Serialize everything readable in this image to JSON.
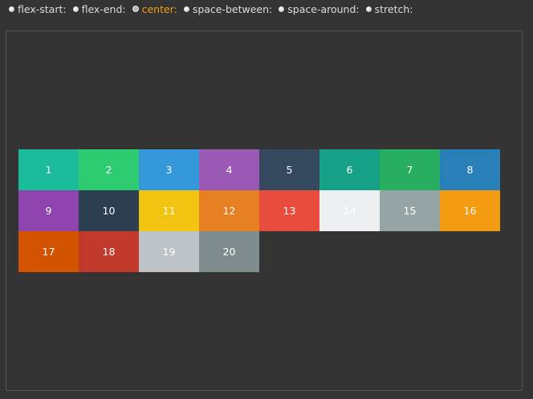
{
  "controls": {
    "options": [
      {
        "label": "flex-start:",
        "selected": false
      },
      {
        "label": "flex-end:",
        "selected": false
      },
      {
        "label": "center:",
        "selected": true
      },
      {
        "label": "space-between:",
        "selected": false
      },
      {
        "label": "space-around:",
        "selected": false
      },
      {
        "label": "stretch:",
        "selected": false
      }
    ],
    "selected_color": "#f39c12"
  },
  "boxes": [
    {
      "label": "1",
      "color": "#1abc9c"
    },
    {
      "label": "2",
      "color": "#2ecc71"
    },
    {
      "label": "3",
      "color": "#3498db"
    },
    {
      "label": "4",
      "color": "#9b59b6"
    },
    {
      "label": "5",
      "color": "#34495e"
    },
    {
      "label": "6",
      "color": "#16a085"
    },
    {
      "label": "7",
      "color": "#27ae60"
    },
    {
      "label": "8",
      "color": "#2980b9"
    },
    {
      "label": "9",
      "color": "#8e44ad"
    },
    {
      "label": "10",
      "color": "#2c3e50"
    },
    {
      "label": "11",
      "color": "#f1c40f"
    },
    {
      "label": "12",
      "color": "#e67e22"
    },
    {
      "label": "13",
      "color": "#e74c3c"
    },
    {
      "label": "14",
      "color": "#ecf0f1"
    },
    {
      "label": "15",
      "color": "#95a5a6"
    },
    {
      "label": "16",
      "color": "#f39c12"
    },
    {
      "label": "17",
      "color": "#d35400"
    },
    {
      "label": "18",
      "color": "#c0392b"
    },
    {
      "label": "19",
      "color": "#bdc3c7"
    },
    {
      "label": "20",
      "color": "#7f8c8d"
    }
  ]
}
